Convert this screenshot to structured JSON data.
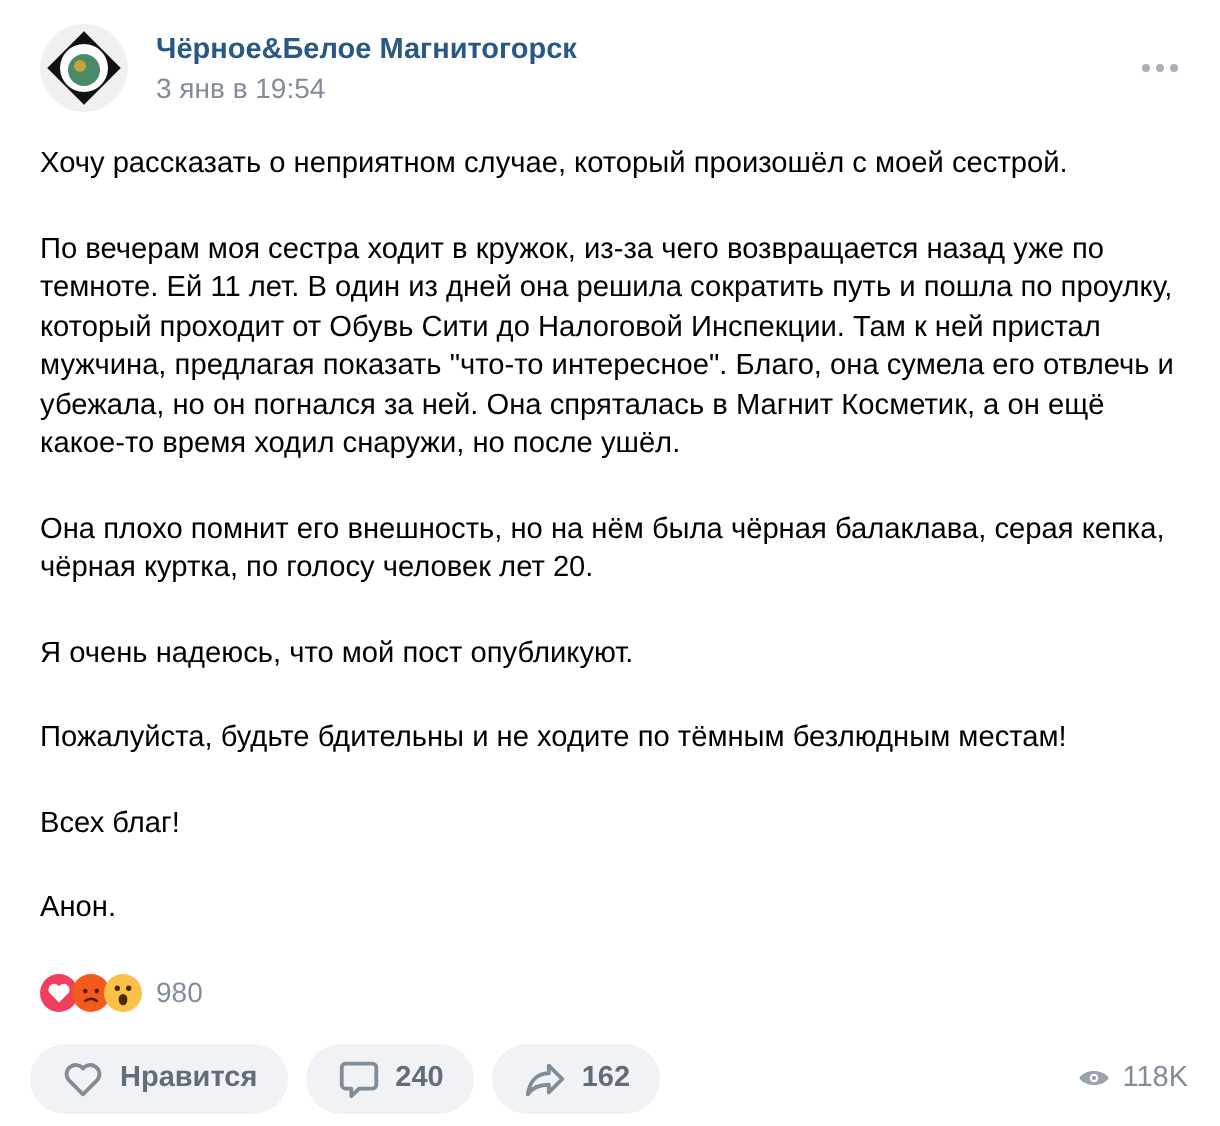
{
  "post": {
    "author": "Чёрное&Белое Магнитогорск",
    "date": "3 янв в 19:54",
    "paragraphs": [
      "Хочу рассказать о неприятном случае, который произошёл с моей сестрой.",
      "По вечерам моя сестра ходит в кружок, из-за чего возвращается назад уже по темноте. Ей 11 лет. В один из дней она решила сократить путь и пошла по проулку, который проходит от Обувь Сити до Налоговой Инспекции. Там к ней пристал мужчина, предлагая показать \"что-то интересное\". Благо, она сумела его отвлечь и убежала, но он погнался за ней. Она спряталась в Магнит Косметик, а он ещё какое-то время ходил снаружи, но после ушёл.",
      "Она плохо помнит его внешность, но на нём была чёрная балаклава, серая кепка, чёрная куртка, по голосу человек лет 20.",
      "Я очень надеюсь, что мой пост опубликуют.",
      "Пожалуйста, будьте бдительны и не ходите по тёмным безлюдным местам!",
      "Всех благ!",
      "Анон."
    ],
    "reactions": {
      "count": "980",
      "items": [
        {
          "kind": "heart"
        },
        {
          "kind": "angry"
        },
        {
          "kind": "surprised"
        }
      ]
    },
    "actions": [
      {
        "kind": "like",
        "label": "Нравится"
      },
      {
        "kind": "comment",
        "label": "240"
      },
      {
        "kind": "share",
        "label": "162"
      }
    ],
    "views": "118K"
  }
}
